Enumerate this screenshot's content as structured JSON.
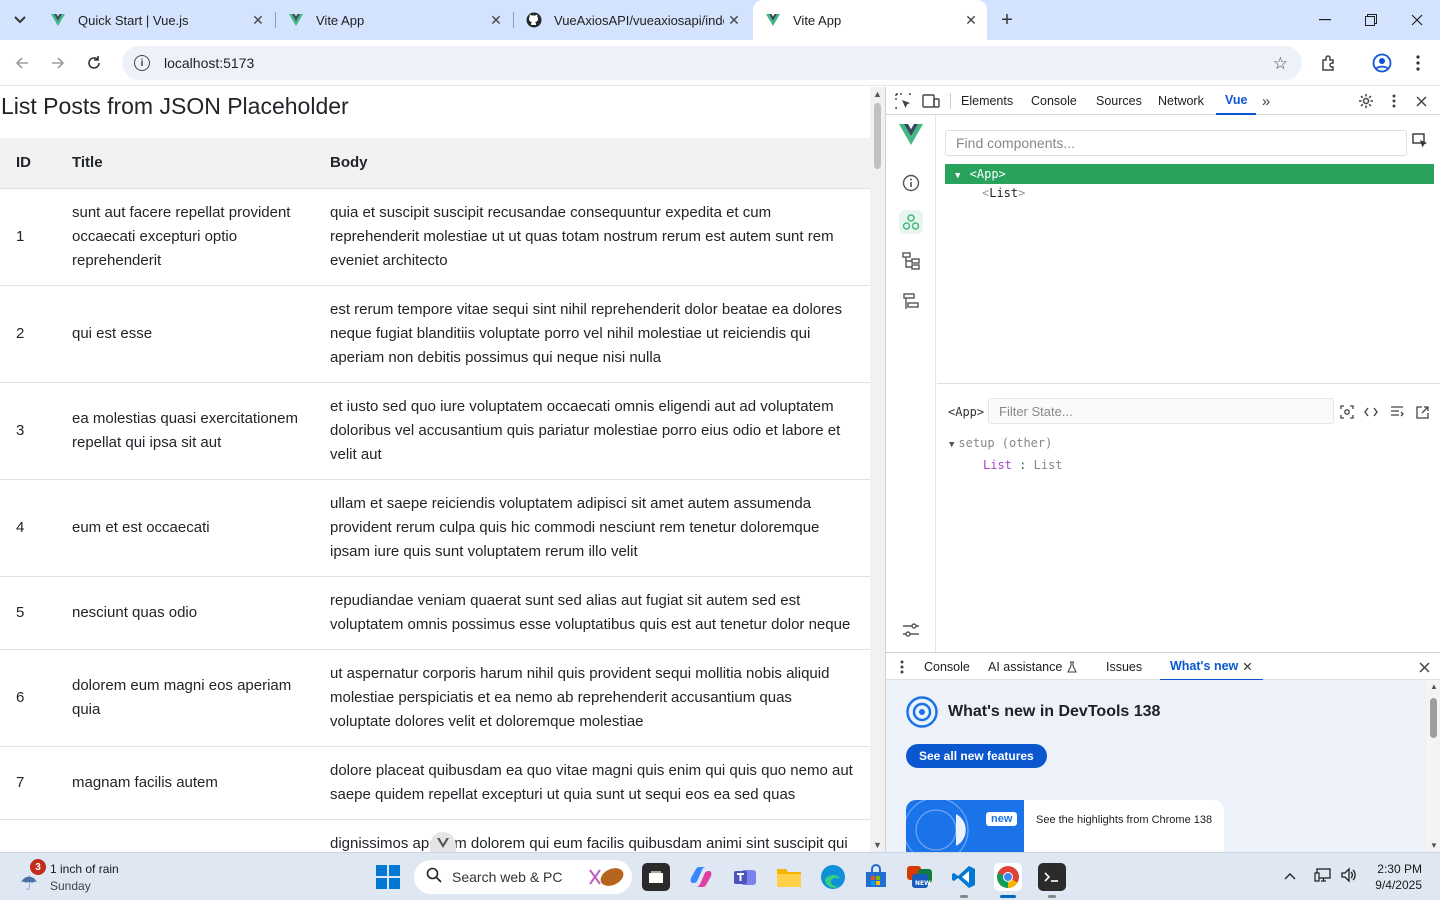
{
  "browser": {
    "tabs": [
      {
        "title": "Quick Start | Vue.js",
        "favicon": "vue-logo",
        "active": false
      },
      {
        "title": "Vite App",
        "favicon": "vue-logo",
        "active": false
      },
      {
        "title": "VueAxiosAPI/vueaxiosapi/index.",
        "favicon": "github-logo",
        "active": false
      },
      {
        "title": "Vite App",
        "favicon": "vue-logo",
        "active": true
      }
    ],
    "url": "localhost:5173"
  },
  "page": {
    "heading": "List Posts from JSON Placeholder",
    "columns": [
      "ID",
      "Title",
      "Body"
    ],
    "rows": [
      {
        "id": "1",
        "title": "sunt aut facere repellat provident occaecati excepturi optio reprehenderit",
        "body": "quia et suscipit suscipit recusandae consequuntur expedita et cum reprehenderit molestiae ut ut quas totam nostrum rerum est autem sunt rem eveniet architecto"
      },
      {
        "id": "2",
        "title": "qui est esse",
        "body": "est rerum tempore vitae sequi sint nihil reprehenderit dolor beatae ea dolores neque fugiat blanditiis voluptate porro vel nihil molestiae ut reiciendis qui aperiam non debitis possimus qui neque nisi nulla"
      },
      {
        "id": "3",
        "title": "ea molestias quasi exercitationem repellat qui ipsa sit aut",
        "body": "et iusto sed quo iure voluptatem occaecati omnis eligendi aut ad voluptatem doloribus vel accusantium quis pariatur molestiae porro eius odio et labore et velit aut"
      },
      {
        "id": "4",
        "title": "eum et est occaecati",
        "body": "ullam et saepe reiciendis voluptatem adipisci sit amet autem assumenda provident rerum culpa quis hic commodi nesciunt rem tenetur doloremque ipsam iure quis sunt voluptatem rerum illo velit"
      },
      {
        "id": "5",
        "title": "nesciunt quas odio",
        "body": "repudiandae veniam quaerat sunt sed alias aut fugiat sit autem sed est voluptatem omnis possimus esse voluptatibus quis est aut tenetur dolor neque"
      },
      {
        "id": "6",
        "title": "dolorem eum magni eos aperiam quia",
        "body": "ut aspernatur corporis harum nihil quis provident sequi mollitia nobis aliquid molestiae perspiciatis et ea nemo ab reprehenderit accusantium quas voluptate dolores velit et doloremque molestiae"
      },
      {
        "id": "7",
        "title": "magnam facilis autem",
        "body": "dolore placeat quibusdam ea quo vitae magni quis enim qui quis quo nemo aut saepe quidem repellat excepturi ut quia sunt ut sequi eos ea sed quas"
      },
      {
        "id": "",
        "title": "",
        "body": "dignissimos aperiam dolorem qui eum facilis quibusdam animi sint suscipit qui"
      }
    ]
  },
  "devtools": {
    "tabs": [
      "Elements",
      "Console",
      "Sources",
      "Network",
      "Vue"
    ],
    "active_tab": "Vue",
    "find_placeholder": "Find components...",
    "tree": {
      "root": "<App>",
      "child_name": "List"
    },
    "state_component": "<App>",
    "filter_placeholder": "Filter State...",
    "setup_label": "setup (other)",
    "state_key": "List",
    "state_value": "List",
    "drawer_tabs": [
      "Console",
      "AI assistance",
      "Issues",
      "What's new"
    ],
    "drawer_active": "What's new",
    "whats_new_title": "What's new in DevTools 138",
    "see_all_label": "See all new features",
    "card_badge": "new",
    "card_text": "See the highlights from Chrome 138"
  },
  "taskbar": {
    "weather_badge": "3",
    "weather_line1": "1 inch of rain",
    "weather_line2": "Sunday",
    "search_text": "Search web & PC",
    "time": "2:30 PM",
    "date": "9/4/2025"
  },
  "colors": {
    "tab_strip": "#d3e3fd",
    "vue_green": "#42b883",
    "devtools_accent": "#0b57d0",
    "tree_selected": "#27a35b"
  }
}
